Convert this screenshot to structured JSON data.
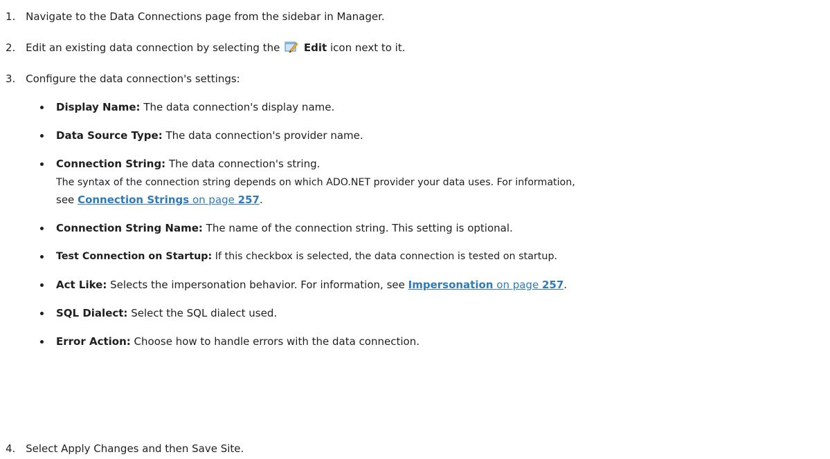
{
  "steps": [
    {
      "num": "1.",
      "text": "Navigate to the Data Connections page from the sidebar in Manager."
    },
    {
      "num": "2.",
      "pre": "Edit an existing data connection by selecting the",
      "bold": "Edit",
      "post": "icon next to it."
    },
    {
      "num": "3.",
      "text": "Configure the data connection's settings:"
    },
    {
      "num": "4.",
      "text": "Select Apply Changes and then Save Site."
    }
  ],
  "settings": [
    {
      "term": "Display Name:",
      "desc": "The data connection's display name."
    },
    {
      "term": "Data Source Type:",
      "desc": "The data connection's provider name."
    },
    {
      "term": "Connection String:",
      "desc": "The data connection's string.",
      "extra_line1": "The syntax of the connection string depends on which ADO.NET provider your data uses. For information,",
      "extra_pre": "see",
      "link_bold": "Connection Strings",
      "link_rest": "on page",
      "link_page": "257",
      "extra_post": "."
    },
    {
      "term": "Connection String Name:",
      "desc": "The name of the connection string. This setting is optional."
    },
    {
      "term": "Test Connection on Startup:",
      "desc": "If this checkbox is selected, the data connection is tested on startup."
    },
    {
      "term": "Act Like:",
      "desc": "Selects the impersonation behavior. For information, see",
      "link_bold": "Impersonation",
      "link_rest": "on page",
      "link_page": "257",
      "post": "."
    },
    {
      "term": "SQL Dialect:",
      "desc": "Select the SQL dialect used."
    },
    {
      "term": "Error Action:",
      "desc": "Choose how to handle errors with the data connection."
    }
  ],
  "colors": {
    "text": "#1f1f1f",
    "link": "#2f7ab8"
  },
  "icons": {
    "edit": "edit-pencil-icon"
  }
}
